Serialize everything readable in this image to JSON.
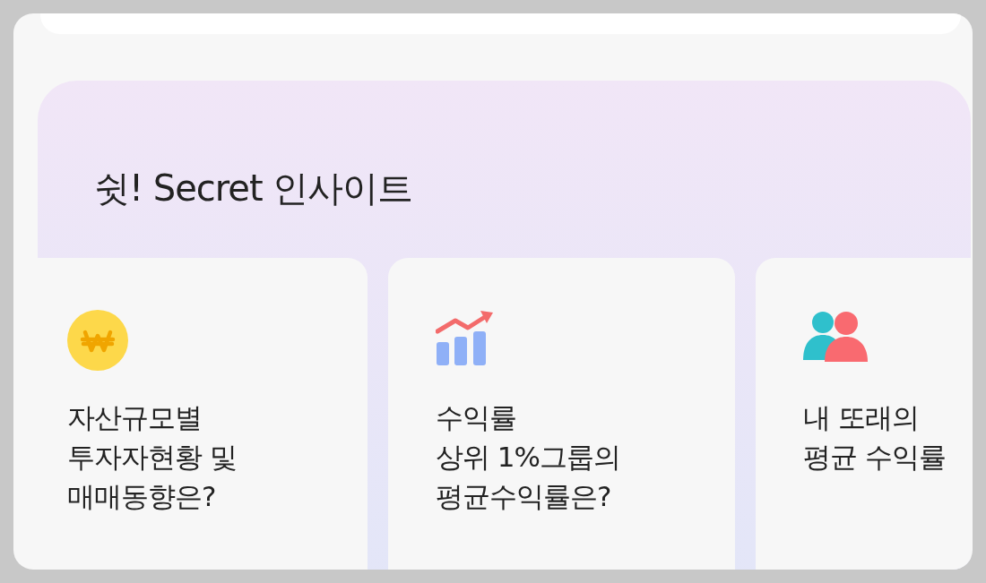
{
  "section": {
    "title": "쉿! Secret 인사이트"
  },
  "cards": [
    {
      "kind": "won",
      "lines": [
        "자산규모별",
        "투자자현황 및",
        "매매동향은?"
      ]
    },
    {
      "kind": "chart",
      "lines": [
        "수익률",
        "상위 1%그룹의",
        "평균수익률은?"
      ]
    },
    {
      "kind": "people",
      "lines": [
        "내 또래의",
        "평균 수익률"
      ]
    }
  ]
}
